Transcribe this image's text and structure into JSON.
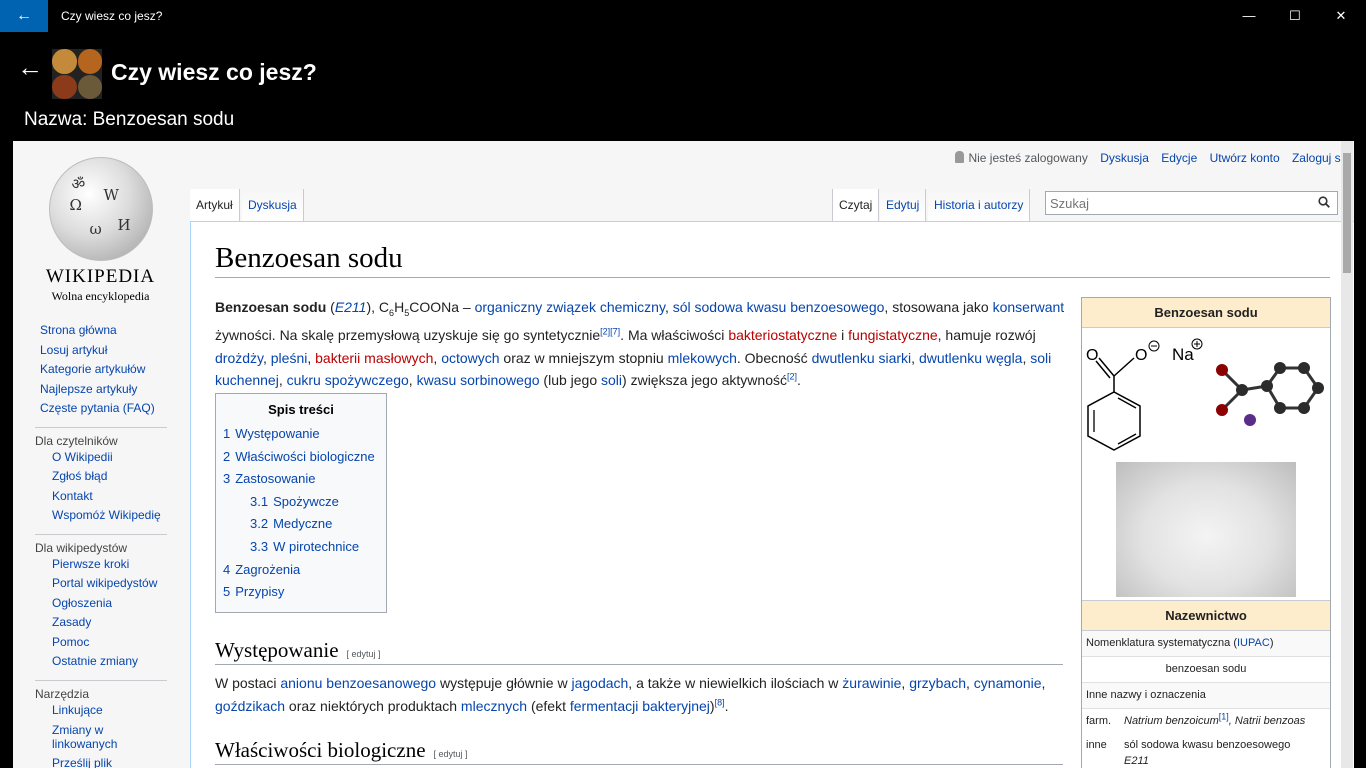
{
  "window": {
    "title": "Czy wiesz co jesz?",
    "back_glyph": "←",
    "minimize_glyph": "—",
    "maximize_glyph": "☐",
    "close_glyph": "✕"
  },
  "app": {
    "back_glyph": "←",
    "title": "Czy wiesz co jesz?",
    "subtitle": "Nazwa: Benzoesan sodu"
  },
  "wiki": {
    "logo_title": "Wikipedia",
    "logo_tagline": "Wolna encyklopedia",
    "sidebar": {
      "main": [
        "Strona główna",
        "Losuj artykuł",
        "Kategorie artykułów",
        "Najlepsze artykuły",
        "Częste pytania (FAQ)"
      ],
      "readers_heading": "Dla czytelników",
      "readers": [
        "O Wikipedii",
        "Zgłoś błąd",
        "Kontakt",
        "Wspomóż Wikipedię"
      ],
      "editors_heading": "Dla wikipedystów",
      "editors": [
        "Pierwsze kroki",
        "Portal wikipedystów",
        "Ogłoszenia",
        "Zasady",
        "Pomoc",
        "Ostatnie zmiany"
      ],
      "tools_heading": "Narzędzia",
      "tools": [
        "Linkujące",
        "Zmiany w linkowanych",
        "Prześlij plik"
      ]
    },
    "personal": {
      "not_logged": "Nie jesteś zalogowany",
      "discussion": "Dyskusja",
      "edits": "Edycje",
      "create_account": "Utwórz konto",
      "login": "Zaloguj się"
    },
    "tabs": {
      "article": "Artykuł",
      "discussion": "Dyskusja",
      "read": "Czytaj",
      "edit": "Edytuj",
      "history": "Historia i autorzy"
    },
    "search": {
      "placeholder": "Szukaj"
    },
    "article": {
      "title": "Benzoesan sodu",
      "lead": {
        "bold": "Benzoesan sodu",
        "e211": "E211",
        "formula_a": "), C",
        "formula_b": "6",
        "formula_c": "H",
        "formula_d": "5",
        "formula_e": "COONa – ",
        "link1": "organiczny związek chemiczny",
        "comma1": ", ",
        "link2": "sól sodowa kwasu benzoesowego",
        "t1": ", stosowana jako ",
        "link3": "konserwant",
        "t2": " żywności. Na skalę przemysłową uzyskuje się go syntetycznie",
        "ref1": "[2][7]",
        "t3": ". Ma właściwości ",
        "red1": "bakteriostatyczne",
        "t4": " i ",
        "red2": "fungistatyczne",
        "t5": ", hamuje rozwój ",
        "link4": "drożdży",
        "link5": "pleśni",
        "red3": "bakterii masłowych",
        "link6": "octowych",
        "t6": " oraz w mniejszym stopniu ",
        "link7": "mlekowych",
        "t7": ". Obecność ",
        "link8": "dwutlenku siarki",
        "link9": "dwutlenku węgla",
        "link10": "soli kuchennej",
        "link11": "cukru spożywczego",
        "link12": "kwasu sorbinowego",
        "t8": " (lub jego ",
        "link13": "soli",
        "t9": ") zwiększa jego aktywność",
        "ref2": "[2]"
      },
      "toc": {
        "title": "Spis treści",
        "items": [
          {
            "num": "1",
            "label": "Występowanie"
          },
          {
            "num": "2",
            "label": "Właściwości biologiczne"
          },
          {
            "num": "3",
            "label": "Zastosowanie"
          },
          {
            "num": "3.1",
            "label": "Spożywcze"
          },
          {
            "num": "3.2",
            "label": "Medyczne"
          },
          {
            "num": "3.3",
            "label": "W pirotechnice"
          },
          {
            "num": "4",
            "label": "Zagrożenia"
          },
          {
            "num": "5",
            "label": "Przypisy"
          }
        ]
      },
      "edit_label": "[ edytuj ]",
      "section1": {
        "heading": "Występowanie",
        "t1": "W postaci ",
        "link1": "anionu benzoesanowego",
        "t2": " występuje głównie w ",
        "link2": "jagodach",
        "t3": ", a także w niewielkich ilościach w ",
        "link3": "żurawinie",
        "link4": "grzybach",
        "link5": "cynamonie",
        "link6": "goździkach",
        "t4": " oraz niektórych produktach ",
        "link7": "mlecznych",
        "t5": " (efekt ",
        "link8": "fermentacji bakteryjnej",
        "t6": ")",
        "ref": "[8]"
      },
      "section2": {
        "heading": "Właściwości biologiczne"
      }
    },
    "infobox": {
      "title": "Benzoesan sodu",
      "na_label": "Na",
      "o_label1": "O",
      "o_label2": "O",
      "naming_header": "Nazewnictwo",
      "iupac_label": "Nomenklatura systematyczna (",
      "iupac_link": "IUPAC",
      "iupac_end": ")",
      "iupac_value": "benzoesan sodu",
      "other_names": "Inne nazwy i oznaczenia",
      "farm_label": "farm.",
      "farm_value1": "Natrium benzoicum",
      "farm_ref": "[1]",
      "farm_value2": ", Natrii benzoas",
      "other_label": "inne",
      "other_value1": "sól sodowa kwasu benzoesowego",
      "other_value2": "E211"
    }
  }
}
